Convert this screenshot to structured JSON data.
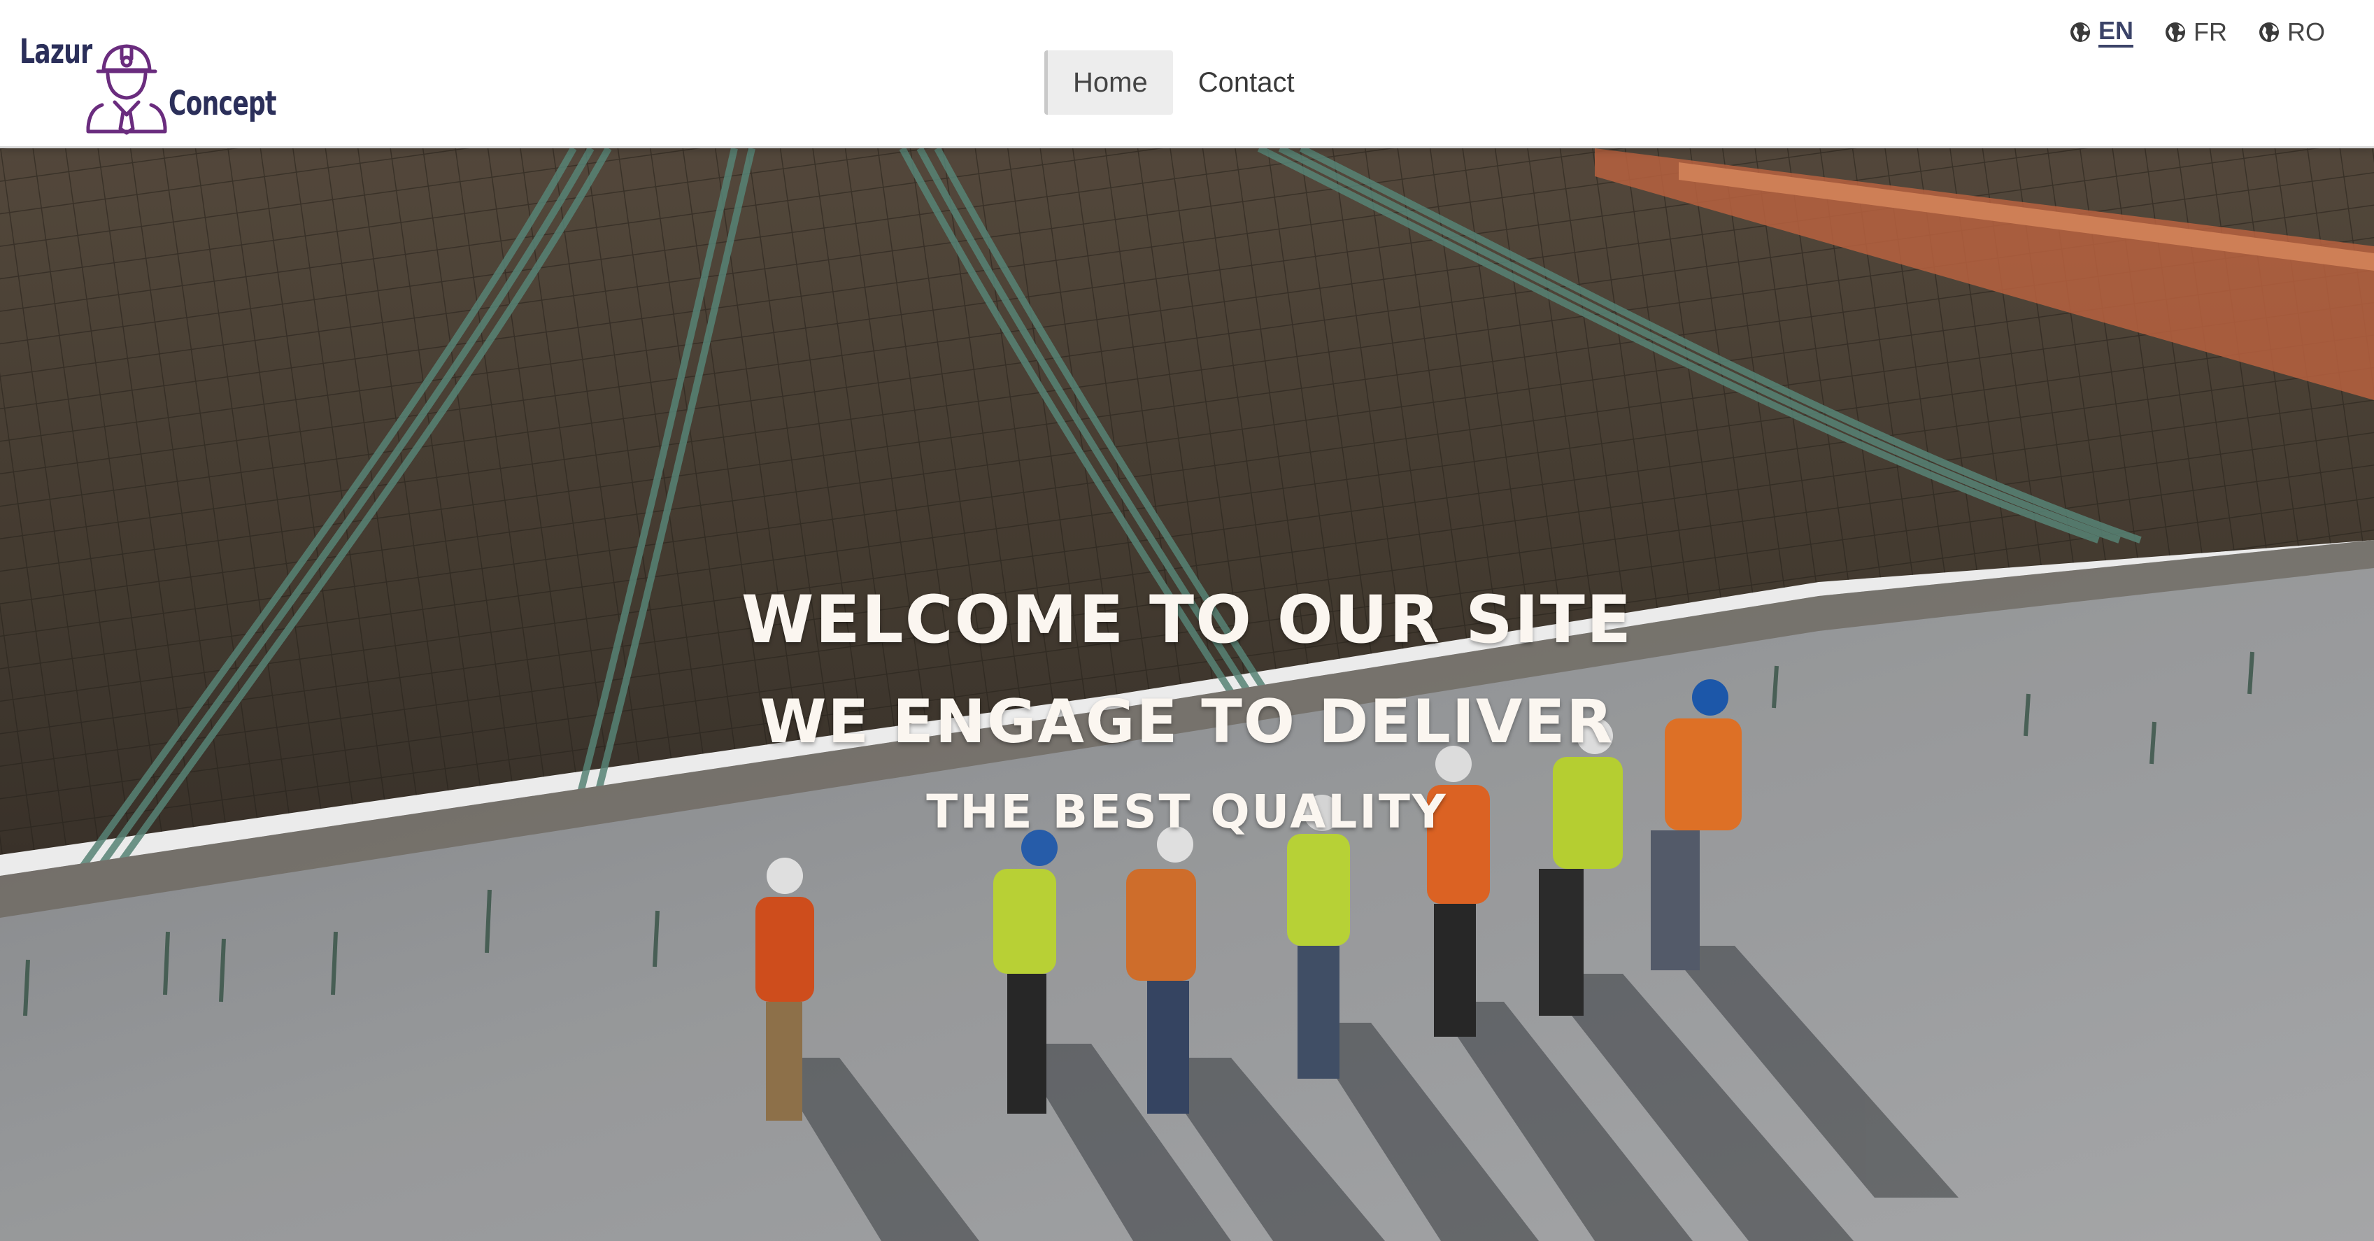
{
  "brand": {
    "word_top": "Lazur",
    "word_bottom": "Concept",
    "color": "#2b2f5a",
    "icon": "construction-worker-icon"
  },
  "nav": {
    "items": [
      {
        "label": "Home",
        "active": true
      },
      {
        "label": "Contact",
        "active": false
      }
    ]
  },
  "languages": [
    {
      "code": "EN",
      "icon": "globe-icon",
      "active": true
    },
    {
      "code": "FR",
      "icon": "globe-icon",
      "active": false
    },
    {
      "code": "RO",
      "icon": "globe-icon",
      "active": false
    }
  ],
  "hero": {
    "line1": "WELCOME TO OUR SITE",
    "line2": "WE ENGAGE TO DELIVER",
    "line3": "THE BEST QUALITY",
    "image": "construction-site-workers-photo"
  }
}
